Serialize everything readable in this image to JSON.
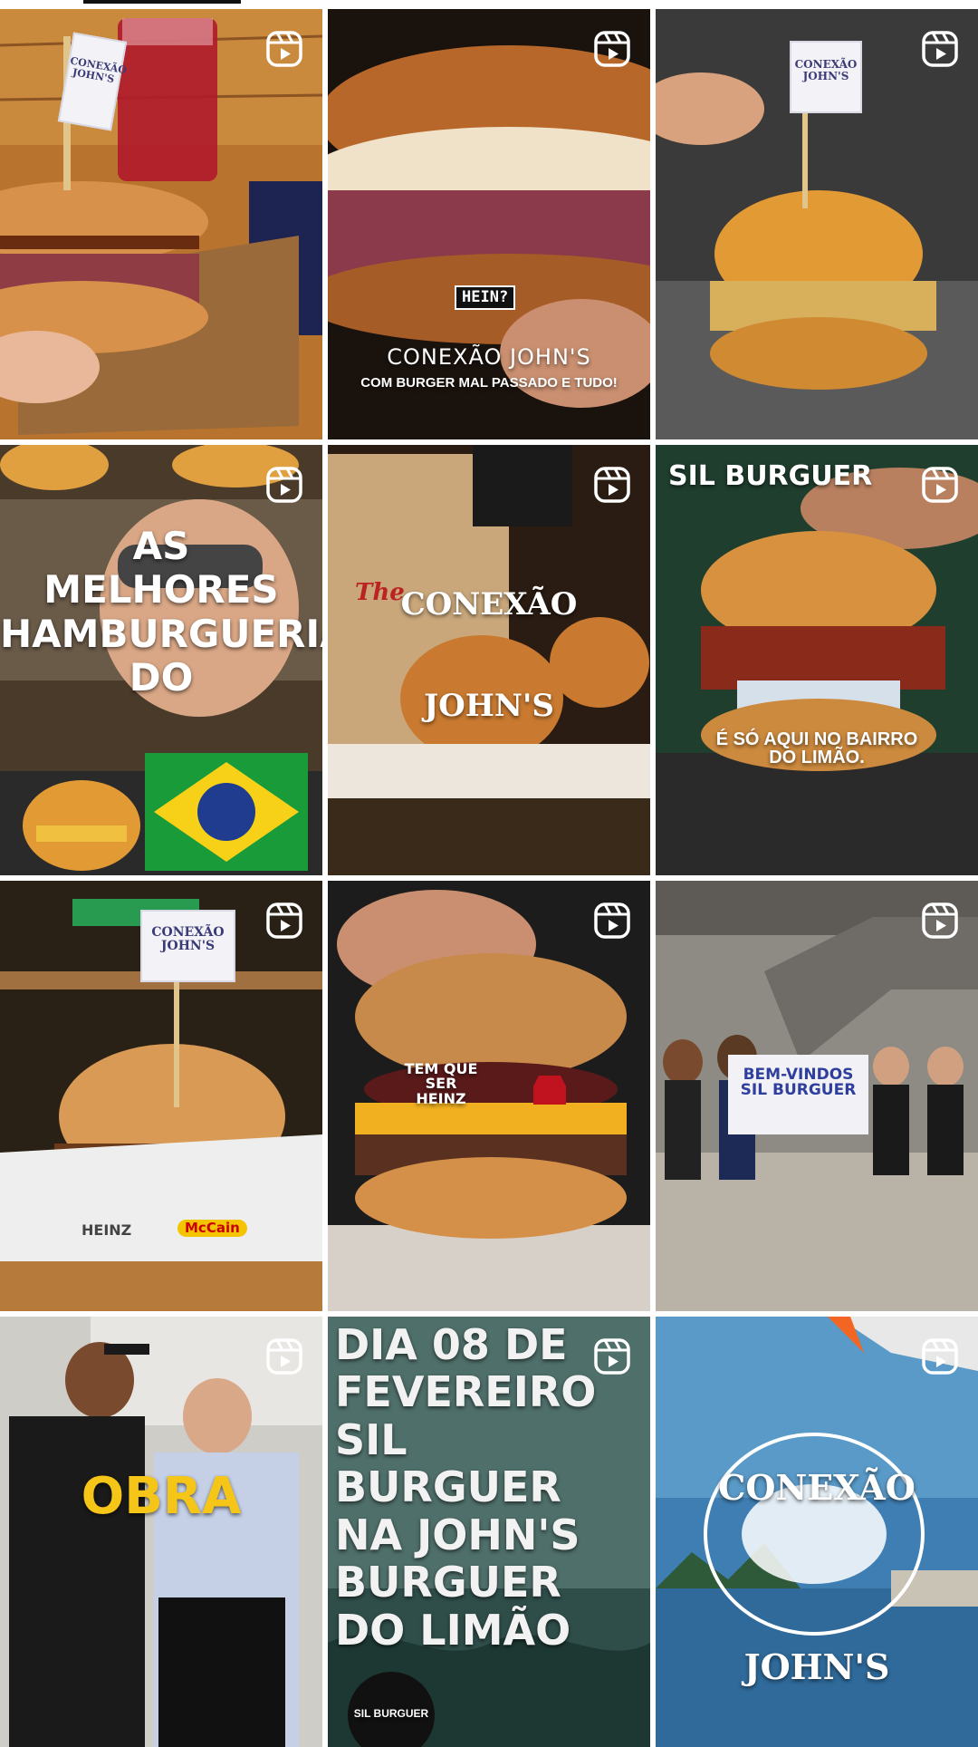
{
  "tiles": [
    {
      "id": "t1",
      "type": "reel",
      "overlay_text": "",
      "flag_text": "CONEXÃO\nJOHN'S"
    },
    {
      "id": "t2",
      "type": "reel",
      "overlay_text": "CONEXÃO JOHN'S",
      "overlay_sub": "COM BURGER MAL PASSADO E TUDO!",
      "tag": "HEIN?"
    },
    {
      "id": "t3",
      "type": "reel",
      "overlay_text": "",
      "flag_text": "CONEXÃO\nJOHN'S"
    },
    {
      "id": "t4",
      "type": "reel",
      "overlay_text": "AS\nMELHORES\nHAMBURGUERIAS\nDO"
    },
    {
      "id": "t5",
      "type": "reel",
      "overlay_text": "CONEXÃO\nJOHN'S",
      "bag_text": "The"
    },
    {
      "id": "t6",
      "type": "reel",
      "overlay_text": "É SÓ AQUI NO BAIRRO\nDO LIMÃO.",
      "top_text": "SIL BURGUER"
    },
    {
      "id": "t7",
      "type": "reel",
      "overlay_text": "",
      "flag_text": "CONEXÃO\nJOHN'S",
      "tray_brands": [
        "HEINZ",
        "McCain"
      ]
    },
    {
      "id": "t8",
      "type": "reel",
      "overlay_text": "TEM QUE\nSER\nHEINZ"
    },
    {
      "id": "t9",
      "type": "reel",
      "overlay_text": "BEM-VINDOS\nSIL BURGUER"
    },
    {
      "id": "t10",
      "type": "reel",
      "overlay_text": "OBRA"
    },
    {
      "id": "t11",
      "type": "reel",
      "overlay_text": "DIA 08 DE\nFEVEREIRO\nSIL BURGUER\nNA JOHN'S\nBURGUER\nDO LIMÃO",
      "badge_text": "SIL BURGUER"
    },
    {
      "id": "t12",
      "type": "reel",
      "overlay_text": "CONEXÃO\nJOHN'S"
    }
  ],
  "colors": {
    "reel_icon": "#ffffff",
    "obra_yellow": "#f5c518",
    "brazil_green": "#1a9b3a",
    "brazil_yellow": "#f7d117",
    "brazil_blue": "#1f3c8f",
    "sign_blue": "#2f3f9e"
  },
  "icons": {
    "reel": "reels-icon"
  }
}
